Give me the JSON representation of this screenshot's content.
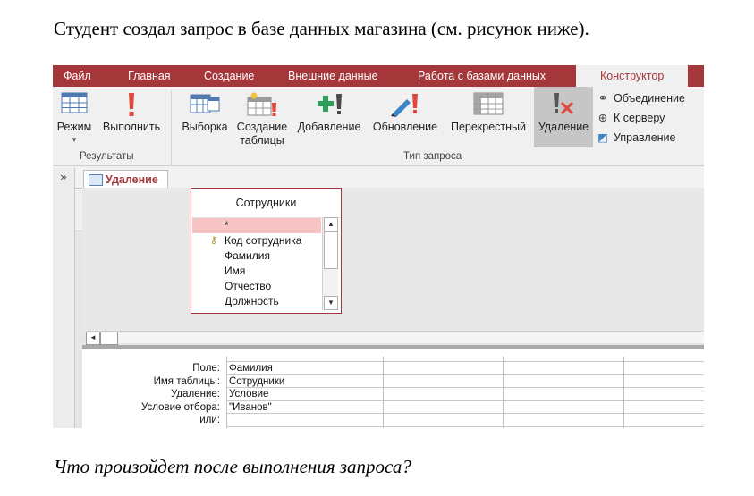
{
  "question_text": "Студент создал запрос в базе данных магазина (см. рисунок ниже).",
  "question_followup": "Что произойдет после выполнения запроса?",
  "menu": {
    "tabs": [
      "Файл",
      "Главная",
      "Создание",
      "Внешние данные",
      "Работа с базами данных",
      "Конструктор"
    ],
    "active_tab": "Конструктор"
  },
  "ribbon": {
    "buttons": [
      {
        "label": "Режим",
        "sub": "▾",
        "icon": "view-grid-icon"
      },
      {
        "label": "Выполнить",
        "icon": "exclamation-run-icon"
      },
      {
        "label": "Выборка",
        "icon": "select-table-icon"
      },
      {
        "label": "Создание",
        "label2": "таблицы",
        "icon": "make-table-icon"
      },
      {
        "label": "Добавление",
        "icon": "append-icon"
      },
      {
        "label": "Обновление",
        "icon": "update-pencil-icon"
      },
      {
        "label": "Перекрестный",
        "icon": "crosstab-icon"
      },
      {
        "label": "Удаление",
        "icon": "delete-query-icon"
      }
    ],
    "side_items": [
      "Объединение",
      "К серверу",
      "Управление"
    ],
    "groups": [
      "Результаты",
      "Тип запроса"
    ]
  },
  "nav": {
    "toggle": "»"
  },
  "doc_tab": "Удаление",
  "table_box": {
    "title": "Сотрудники",
    "fields": [
      "*",
      "Код сотрудника",
      "Фамилия",
      "Имя",
      "Отчество",
      "Должность"
    ]
  },
  "design_grid": {
    "row_labels": [
      "Поле:",
      "Имя таблицы:",
      "Удаление:",
      "Условие отбора:",
      "или:"
    ],
    "column1": [
      "Фамилия",
      "Сотрудники",
      "Условие",
      "\"Иванов\"",
      ""
    ]
  },
  "colors": {
    "brand": "#a4373a",
    "selected_field": "#f7c3c4"
  }
}
